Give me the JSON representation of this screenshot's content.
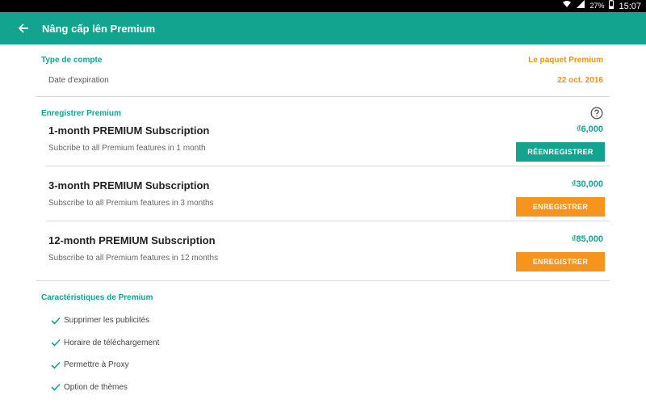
{
  "status_bar": {
    "battery": "27%",
    "time": "15:07"
  },
  "app_bar": {
    "title": "Nâng cấp lên Premium"
  },
  "account": {
    "type_label": "Type de compte",
    "type_value": "Le paquet Premium",
    "expiry_label": "Date d'expiration",
    "expiry_value": "22 oct. 2016"
  },
  "register_section": {
    "title": "Enregistrer Premium",
    "plans": [
      {
        "title": "1-month PREMIUM Subscription",
        "description": "Subcribe to all Premium features in 1 month",
        "price": "₫6,000",
        "button": "RÉENREGISTRER"
      },
      {
        "title": "3-month PREMIUM Subscription",
        "description": "Subscribe to all Premium features in 3 months",
        "price": "₫30,000",
        "button": "ENREGISTRER"
      },
      {
        "title": "12-month PREMIUM Subscription",
        "description": "Subscribe to all Premium features in 12 months",
        "price": "₫85,000",
        "button": "ENREGISTRER"
      }
    ]
  },
  "features_section": {
    "title": "Caractéristiques de Premium",
    "items": [
      "Supprimer les publicités",
      "Horaire de téléchargement",
      "Permettre à Proxy",
      "Option de thèmes"
    ]
  },
  "colors": {
    "primary": "#12a48e",
    "accent": "#f7941d"
  },
  "icons": {
    "back": "arrow-left-icon",
    "help": "help-circle-icon",
    "check": "check-icon"
  }
}
